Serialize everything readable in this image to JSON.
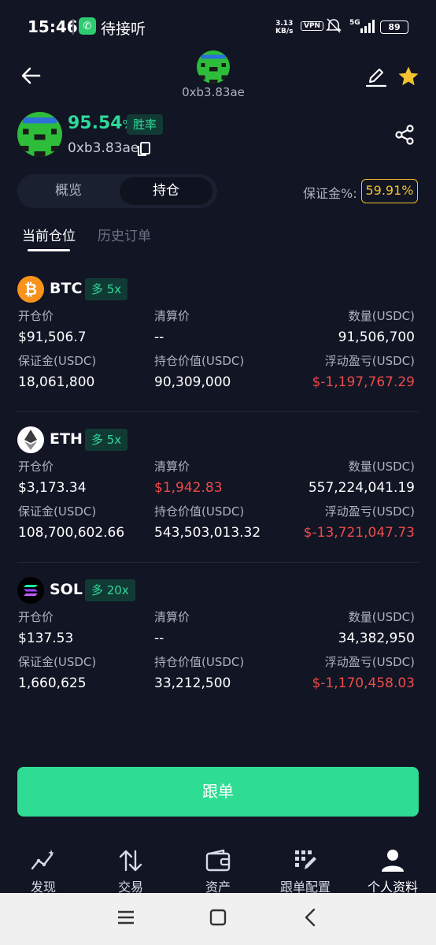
{
  "status_bar": {
    "time": "15:46",
    "call_text": "待接听",
    "net_speed_value": "3.13",
    "net_speed_unit": "KB/s",
    "vpn": "VPN",
    "signal_type": "5G",
    "battery": "89"
  },
  "header": {
    "address": "0xb3.83ae"
  },
  "profile": {
    "win_rate_value": "95.54",
    "win_rate_pct": "%",
    "win_rate_label": "胜率",
    "address": "0xb3.83ae"
  },
  "tabs": {
    "overview": "概览",
    "positions": "持仓",
    "margin_label": "保证金%:",
    "margin_value": "59.91%"
  },
  "subtabs": {
    "current": "当前仓位",
    "history": "历史订单"
  },
  "positions": [
    {
      "coin": "BTC",
      "tag": "多 5x",
      "icon_color": "#f7931a",
      "open_price_label": "开仓价",
      "open_price": "$91,506.7",
      "liq_price_label": "清算价",
      "liq_price": "--",
      "qty_label": "数量(USDC)",
      "qty": "91,506,700",
      "margin_label": "保证金(USDC)",
      "margin": "18,061,800",
      "value_label": "持仓价值(USDC)",
      "value": "90,309,000",
      "pnl_label": "浮动盈亏(USDC)",
      "pnl": "$-1,197,767.29"
    },
    {
      "coin": "ETH",
      "tag": "多 5x",
      "icon_color": "#ffffff",
      "open_price_label": "开仓价",
      "open_price": "$3,173.34",
      "liq_price_label": "清算价",
      "liq_price": "$1,942.83",
      "qty_label": "数量(USDC)",
      "qty": "557,224,041.19",
      "margin_label": "保证金(USDC)",
      "margin": "108,700,602.66",
      "value_label": "持仓价值(USDC)",
      "value": "543,503,013.32",
      "pnl_label": "浮动盈亏(USDC)",
      "pnl": "$-13,721,047.73"
    },
    {
      "coin": "SOL",
      "tag": "多 20x",
      "icon_color": "#000000",
      "open_price_label": "开仓价",
      "open_price": "$137.53",
      "liq_price_label": "清算价",
      "liq_price": "--",
      "qty_label": "数量(USDC)",
      "qty": "34,382,950",
      "margin_label": "保证金(USDC)",
      "margin": "1,660,625",
      "value_label": "持仓价值(USDC)",
      "value": "33,212,500",
      "pnl_label": "浮动盈亏(USDC)",
      "pnl": "$-1,170,458.03"
    }
  ],
  "follow_button": "跟单",
  "bottom_nav": [
    {
      "label": "发现",
      "icon": "discover-chart-icon"
    },
    {
      "label": "交易",
      "icon": "trade-arrows-icon"
    },
    {
      "label": "资产",
      "icon": "wallet-icon"
    },
    {
      "label": "跟单配置",
      "icon": "copy-config-icon"
    },
    {
      "label": "个人资料",
      "icon": "profile-icon"
    }
  ],
  "colors": {
    "background": "#111524",
    "accent_green": "#2ed99a",
    "button_green": "#2edd93",
    "loss_red": "#f04a4a",
    "margin_yellow": "#f2c230"
  }
}
